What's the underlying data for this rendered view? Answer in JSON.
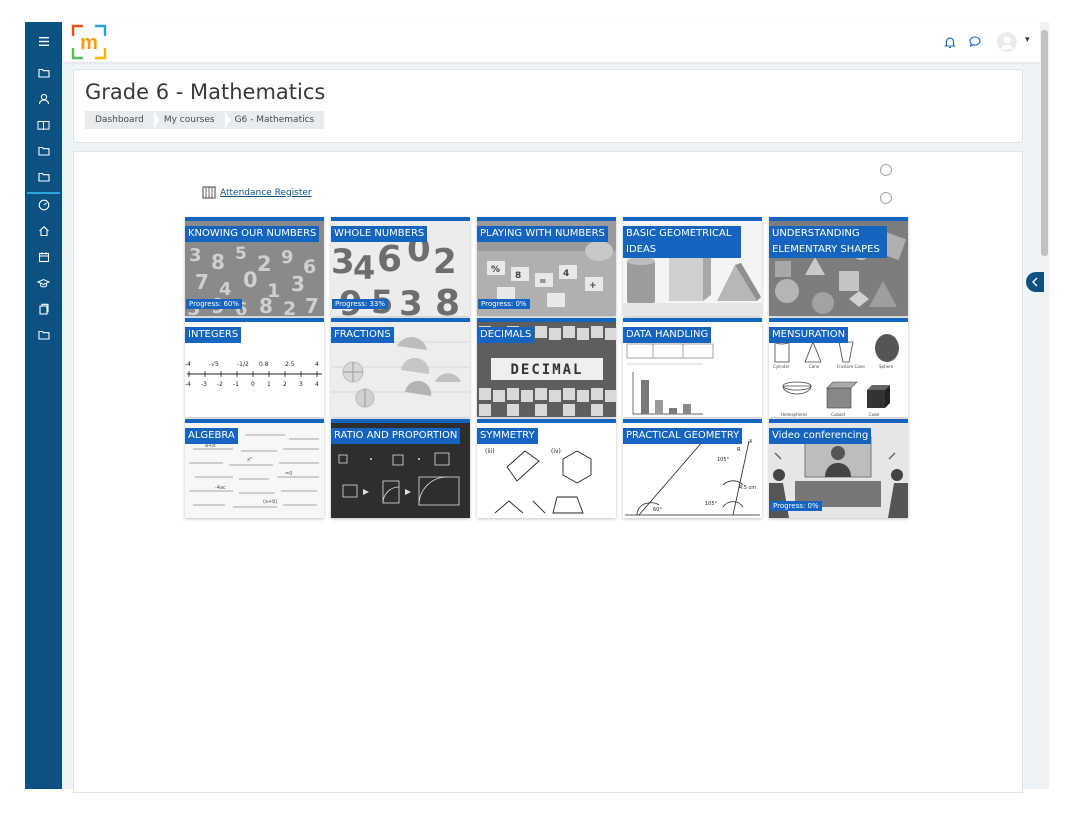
{
  "nav": {
    "menu_icon": "hamburger-icon",
    "items": [
      {
        "icon": "folder-icon"
      },
      {
        "icon": "user-icon"
      },
      {
        "icon": "book-icon"
      },
      {
        "icon": "folder-icon"
      },
      {
        "icon": "folder-icon"
      },
      {
        "icon": "dashboard-icon"
      },
      {
        "icon": "home-icon"
      },
      {
        "icon": "calendar-icon"
      },
      {
        "icon": "graduation-cap-icon"
      },
      {
        "icon": "files-icon"
      },
      {
        "icon": "folder-icon"
      }
    ]
  },
  "topbar": {
    "logo_letter": "m",
    "icons": [
      "bell-icon",
      "chat-icon",
      "avatar-icon",
      "caret-down-icon"
    ],
    "caret": "▾"
  },
  "header": {
    "title": "Grade 6 - Mathematics",
    "breadcrumb": [
      "Dashboard",
      "My courses",
      "G6 - Mathematics"
    ]
  },
  "content": {
    "attendance_link": "Attendance Register",
    "tiles": [
      {
        "label": "KNOWING OUR NUMBERS",
        "progress": "Progress: 60%",
        "progress_value": 60
      },
      {
        "label": "WHOLE NUMBERS",
        "progress": "Progress: 33%",
        "progress_value": 33
      },
      {
        "label": "PLAYING WITH NUMBERS",
        "progress": "Progress: 0%",
        "progress_value": 0
      },
      {
        "label": "BASIC GEOMETRICAL IDEAS",
        "progress": ""
      },
      {
        "label": "UNDERSTANDING ELEMENTARY SHAPES",
        "progress": ""
      },
      {
        "label": "INTEGERS",
        "progress": ""
      },
      {
        "label": "FRACTIONS",
        "progress": ""
      },
      {
        "label": "DECIMALS",
        "progress": ""
      },
      {
        "label": "DATA HANDLING",
        "progress": ""
      },
      {
        "label": "MENSURATION",
        "progress": ""
      },
      {
        "label": "ALGEBRA",
        "progress": ""
      },
      {
        "label": "RATIO AND PROPORTION",
        "progress": ""
      },
      {
        "label": "SYMMETRY",
        "progress": ""
      },
      {
        "label": "PRACTICAL GEOMETRY",
        "progress": ""
      },
      {
        "label": "Video conferencing",
        "progress": "Progress: 0%",
        "progress_value": 0
      }
    ],
    "integers_ticks": [
      "-4",
      "-√5",
      "-1/2",
      "0.8",
      "2.5",
      "4",
      "-4",
      "-3",
      "-2",
      "-1",
      "0",
      "1",
      "2",
      "3",
      "4"
    ],
    "decimal_word": "DECIMAL",
    "mensuration_labels": [
      "Cylinder",
      "Cone",
      "Frustum Cone",
      "Sphere",
      "Hemispheres",
      "Cuboid",
      "Cube"
    ],
    "symmetry_labels": [
      "(iii)",
      "(iv)"
    ],
    "geometry_labels": [
      "X",
      "R",
      "105°",
      "4.5 cm",
      "105°",
      "60°"
    ]
  },
  "colors": {
    "sidebar": "#0b5283",
    "accent": "#1565c0",
    "page_bg": "#eef3f7"
  }
}
